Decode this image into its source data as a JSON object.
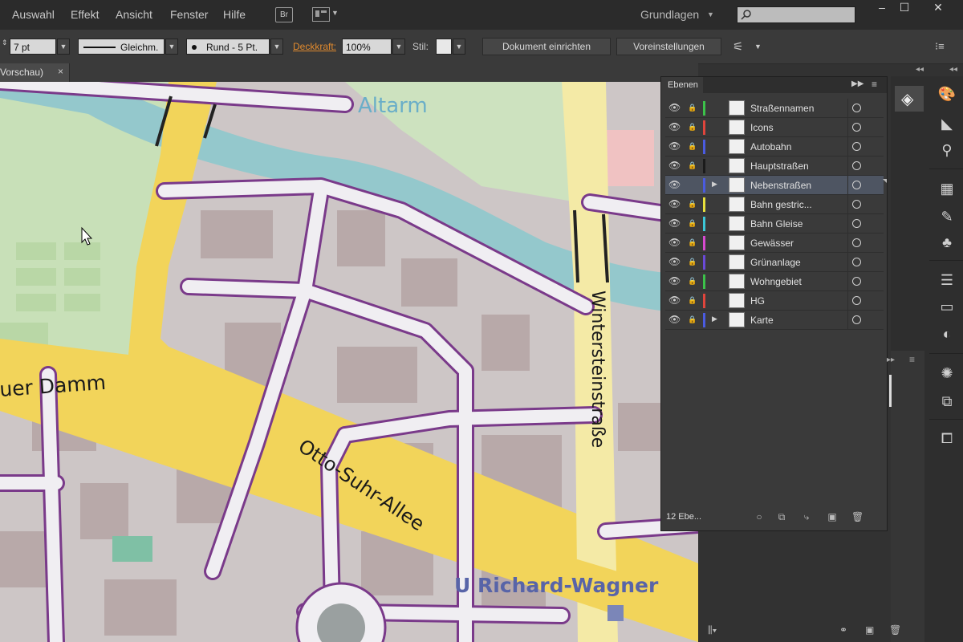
{
  "menubar": {
    "items": [
      "Auswahl",
      "Effekt",
      "Ansicht",
      "Fenster",
      "Hilfe"
    ],
    "bridge_label": "Br",
    "workspace": "Grundlagen",
    "search_placeholder": ""
  },
  "control_bar": {
    "stroke_weight": "7 pt",
    "stroke_profile": "Gleichm.",
    "brush": "Rund - 5 Pt.",
    "opacity_label": "Deckkraft:",
    "opacity_value": "100%",
    "style_label": "Stil:",
    "doc_setup_button": "Dokument einrichten",
    "prefs_button": "Voreinstellungen"
  },
  "document_tab": {
    "title": "Vorschau)",
    "close": "×"
  },
  "map": {
    "labels": {
      "altarm": "Altarm",
      "damm": "uer Damm",
      "otto_suhr": "Otto-Suhr-Allee",
      "wintersteinstrasse": "Wintersteinstraße",
      "richard_wagner": "U Richard-Wagner"
    }
  },
  "layers_panel": {
    "title": "Ebenen",
    "count_label": "12 Ebe...",
    "layers": [
      {
        "name": "Straßennamen",
        "color": "#3cc24a",
        "expandable": false,
        "selected": false,
        "locked": true
      },
      {
        "name": "Icons",
        "color": "#e0453c",
        "expandable": false,
        "selected": false,
        "locked": true
      },
      {
        "name": "Autobahn",
        "color": "#4a5be0",
        "expandable": false,
        "selected": false,
        "locked": true
      },
      {
        "name": "Hauptstraßen",
        "color": "#1b1b1b",
        "expandable": false,
        "selected": false,
        "locked": true
      },
      {
        "name": "Nebenstraßen",
        "color": "#4a5be0",
        "expandable": true,
        "selected": true,
        "locked": false
      },
      {
        "name": "Bahn gestric...",
        "color": "#e8e03c",
        "expandable": false,
        "selected": false,
        "locked": true
      },
      {
        "name": "Bahn Gleise",
        "color": "#3cc8d8",
        "expandable": false,
        "selected": false,
        "locked": true
      },
      {
        "name": "Gewässer",
        "color": "#d84ad0",
        "expandable": false,
        "selected": false,
        "locked": true
      },
      {
        "name": "Grünanlage",
        "color": "#6a4ad8",
        "expandable": false,
        "selected": false,
        "locked": true
      },
      {
        "name": "Wohngebiet",
        "color": "#3cc24a",
        "expandable": false,
        "selected": false,
        "locked": true
      },
      {
        "name": "HG",
        "color": "#e0453c",
        "expandable": false,
        "selected": false,
        "locked": true
      },
      {
        "name": "Karte",
        "color": "#4a5be0",
        "expandable": true,
        "selected": false,
        "locked": true
      }
    ]
  },
  "icons": {
    "eye": "👁",
    "lock": "🔒",
    "expand": "▶",
    "dropdown": "▼",
    "minimize": "–",
    "maximize": "☐",
    "close": "✕"
  }
}
